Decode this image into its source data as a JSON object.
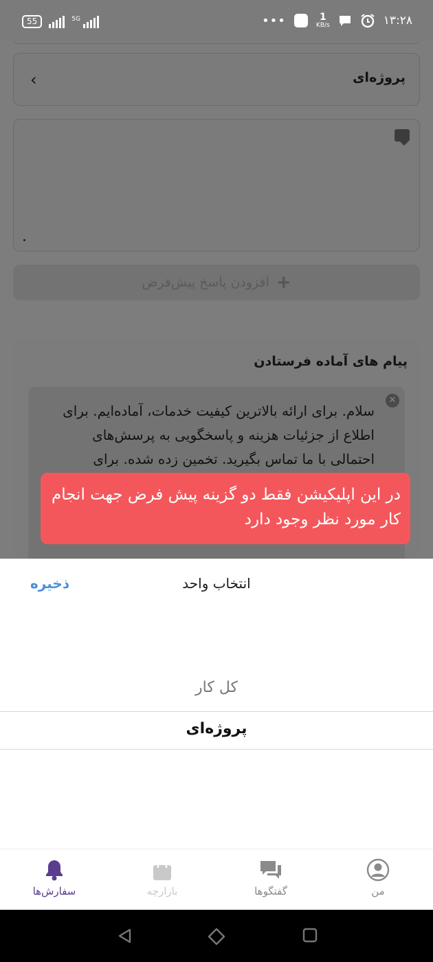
{
  "status_bar": {
    "battery": "55",
    "network": "5G",
    "speed_value": "1",
    "speed_unit": "KB/s",
    "time": "۱۳:۲۸"
  },
  "background": {
    "select_value": "پروژه‌ای",
    "add_default_reply": "افزودن پاسخ پیش‌فرض",
    "ready_messages_title": "پیام های آماده فرستادن",
    "message_text": "سلام. برای ارائه بالاترین کیفیت خدمات، آماده‌ایم. برای اطلاع از جزئیات هزینه و پاسخگویی به پرسش‌های احتمالی با ما تماس بگیرید. تخمین زده شده. برای اطلاعات بیشتر از جزئیات"
  },
  "banner": {
    "text": "در این اپلیکیشن فقط دو گزینه پیش فرض جهت انجام کار مورد نظر وجود دارد"
  },
  "sheet": {
    "title": "انتخاب واحد",
    "save_label": "ذخیره",
    "options": [
      "کل کار",
      "پروژه‌ای"
    ],
    "selected": "پروژه‌ای"
  },
  "bottom_nav": {
    "items": [
      {
        "label": "سفارش‌ها",
        "icon": "bell-icon",
        "active": true
      },
      {
        "label": "بازارچه",
        "icon": "shopping-bag-icon",
        "active": false
      },
      {
        "label": "گفتگوها",
        "icon": "chat-icon",
        "active": false
      },
      {
        "label": "من",
        "icon": "user-icon",
        "active": false
      }
    ]
  },
  "colors": {
    "accent": "#5b3d8f",
    "save": "#4a90d9",
    "banner": "#f4575b",
    "overlay": "#7d7d7d"
  }
}
